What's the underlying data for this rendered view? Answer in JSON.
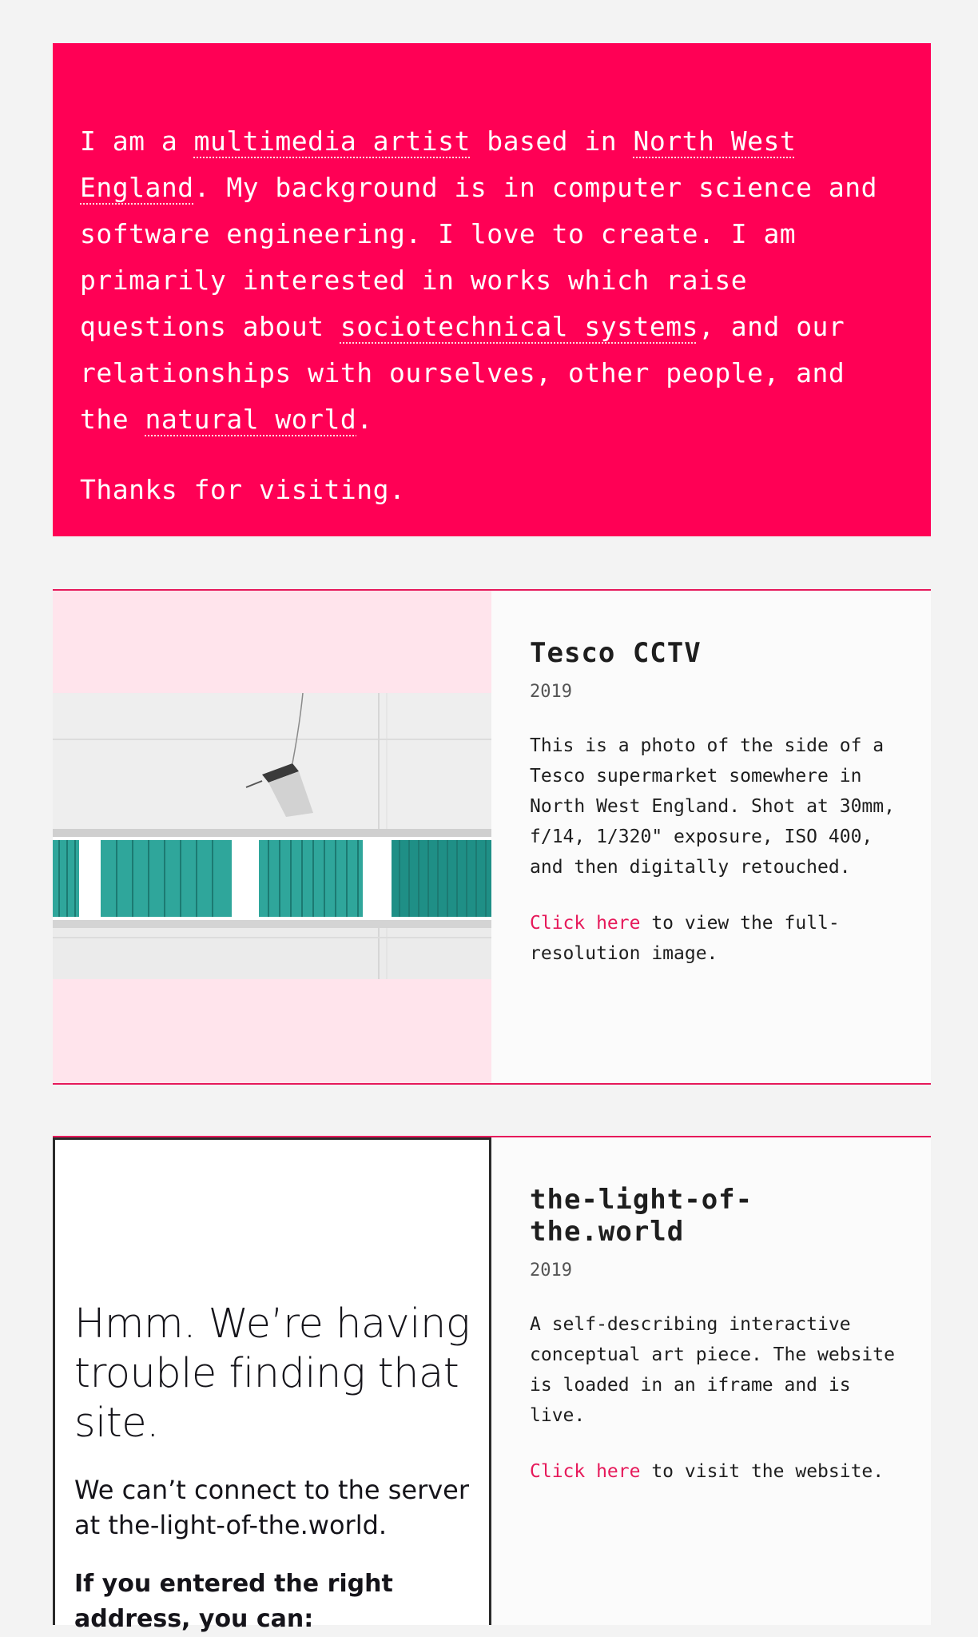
{
  "intro": {
    "seg1": "I am a ",
    "link1": "multimedia artist",
    "seg2": " based in ",
    "link2": "North West England",
    "seg3": ". My background is in computer science and software engineering. I love to create. I am primarily interested in works which raise questions about ",
    "link3": "sociotechnical systems",
    "seg4": ", and our relationships with ourselves, other people, and the ",
    "link4": "natural world",
    "seg5": ".",
    "thanks": "Thanks for visiting."
  },
  "projects": [
    {
      "title": "Tesco CCTV",
      "year": "2019",
      "description": "This is a photo of the side of a Tesco supermarket somewhere in North West England. Shot at 30mm, f/14, 1/320\" exposure, ISO 400, and then digitally retouched.",
      "cta_link": "Click here",
      "cta_rest": " to view the full-resolution image."
    },
    {
      "title": "the-light-of-the.world",
      "year": "2019",
      "description": "A self-describing interactive conceptual art piece. The website is loaded in an iframe and is live.",
      "cta_link": "Click here",
      "cta_rest": " to visit the website.",
      "iframe_error": {
        "heading": "Hmm. We’re having trouble finding that site.",
        "message": "We can’t connect to the server at the-light-of-the.world.",
        "bold": "If you entered the right address, you can:"
      }
    }
  ],
  "colors": {
    "accent": "#ff0055",
    "link": "#e6195a",
    "photo_bg": "#ffe4ec",
    "blinds": "#2fa69b"
  }
}
